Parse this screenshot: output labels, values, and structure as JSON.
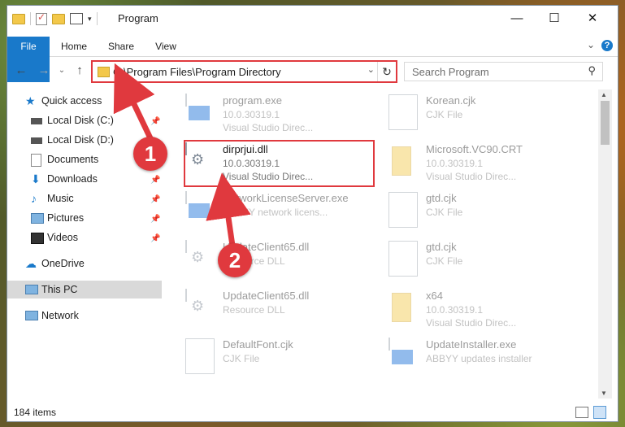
{
  "window": {
    "title": "Program",
    "controls": [
      "minimize-icon",
      "maximize-icon",
      "close-icon"
    ]
  },
  "ribbon": {
    "tabs": [
      "File",
      "Home",
      "Share",
      "View"
    ],
    "help": "?"
  },
  "address": {
    "path": "C:\\Program Files\\Program Directory",
    "search_placeholder": "Search Program"
  },
  "sidebar": {
    "quick_access": "Quick access",
    "items": [
      {
        "label": "Local Disk (C:)",
        "icon": "drive-icon",
        "pinned": true
      },
      {
        "label": "Local Disk (D:)",
        "icon": "drive-icon",
        "pinned": false
      },
      {
        "label": "Documents",
        "icon": "documents-icon",
        "pinned": true
      },
      {
        "label": "Downloads",
        "icon": "download-icon",
        "pinned": true
      },
      {
        "label": "Music",
        "icon": "music-icon",
        "pinned": true
      },
      {
        "label": "Pictures",
        "icon": "pictures-icon",
        "pinned": true
      },
      {
        "label": "Videos",
        "icon": "videos-icon",
        "pinned": true
      }
    ],
    "onedrive": "OneDrive",
    "thispc": "This PC",
    "network": "Network"
  },
  "files": [
    {
      "name": "program.exe",
      "line2": "10.0.30319.1",
      "line3": "Visual Studio Direc...",
      "icon": "exe-icon",
      "faded": true
    },
    {
      "name": "Korean.cjk",
      "line2": "CJK File",
      "line3": "",
      "icon": "document-icon",
      "faded": true
    },
    {
      "name": "dirprjui.dll",
      "line2": "10.0.30319.1",
      "line3": "Visual Studio Direc...",
      "icon": "dll-icon",
      "faded": false
    },
    {
      "name": "Microsoft.VC90.CRT",
      "line2": "10.0.30319.1",
      "line3": "Visual Studio Direc...",
      "icon": "folder-icon",
      "faded": true
    },
    {
      "name": "NetworkLicenseServer.exe",
      "line2": "ABBYY network licens...",
      "line3": "",
      "icon": "exe-icon",
      "faded": true
    },
    {
      "name": "gtd.cjk",
      "line2": "CJK File",
      "line3": "",
      "icon": "document-icon",
      "faded": true
    },
    {
      "name": "UpdateClient65.dll",
      "line2": "Resource DLL",
      "line3": "",
      "icon": "dll-icon",
      "faded": true
    },
    {
      "name": "gtd.cjk",
      "line2": "CJK File",
      "line3": "",
      "icon": "document-icon",
      "faded": true
    },
    {
      "name": "UpdateClient65.dll",
      "line2": "Resource DLL",
      "line3": "",
      "icon": "dll-icon",
      "faded": true
    },
    {
      "name": "x64",
      "line2": "10.0.30319.1",
      "line3": "Visual Studio Direc...",
      "icon": "folder-icon",
      "faded": true
    },
    {
      "name": "DefaultFont.cjk",
      "line2": "CJK File",
      "line3": "",
      "icon": "document-icon",
      "faded": true
    },
    {
      "name": "UpdateInstaller.exe",
      "line2": "ABBYY updates installer",
      "line3": "",
      "icon": "exe-icon",
      "faded": true
    }
  ],
  "status": {
    "item_count": "184 items"
  },
  "annotations": {
    "badge1": "1",
    "badge2": "2",
    "color": "#e0393e"
  }
}
